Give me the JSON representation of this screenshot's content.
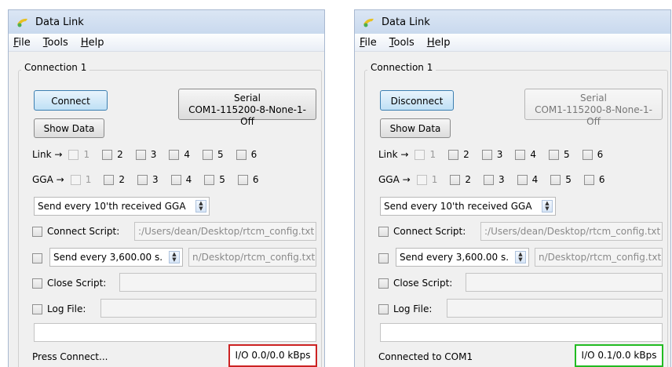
{
  "colors": {
    "io_red": "#cc2222",
    "io_green": "#22bb22"
  },
  "windows": [
    {
      "title": "Data Link",
      "menu": [
        {
          "first": "F",
          "rest": "ile"
        },
        {
          "first": "T",
          "rest": "ools"
        },
        {
          "first": "H",
          "rest": "elp"
        }
      ],
      "group_label": "Connection 1",
      "connect_label": "Connect",
      "show_data_label": "Show Data",
      "serial_line1": "Serial",
      "serial_line2": "COM1-115200-8-None-1-Off",
      "link_label": "Link →",
      "gga_label": "GGA →",
      "nums": [
        "1",
        "2",
        "3",
        "4",
        "5",
        "6"
      ],
      "send_gga": "Send every  10'th received GGA",
      "connect_script_label": "Connect Script:",
      "connect_script_path": ":/Users/dean/Desktop/rtcm_config.txt",
      "send_every": "Send every 3,600.00 s.",
      "send_every_path": "n/Desktop/rtcm_config.txt",
      "close_script_label": "Close Script:",
      "log_file_label": "Log File:",
      "status": "Press Connect...",
      "io": "I/O 0.0/0.0 kBps",
      "io_color": "#cc2222"
    },
    {
      "title": "Data Link",
      "menu": [
        {
          "first": "F",
          "rest": "ile"
        },
        {
          "first": "T",
          "rest": "ools"
        },
        {
          "first": "H",
          "rest": "elp"
        }
      ],
      "group_label": "Connection 1",
      "connect_label": "Disconnect",
      "show_data_label": "Show Data",
      "serial_line1": "Serial",
      "serial_line2": "COM1-115200-8-None-1-Off",
      "link_label": "Link →",
      "gga_label": "GGA →",
      "nums": [
        "1",
        "2",
        "3",
        "4",
        "5",
        "6"
      ],
      "send_gga": "Send every  10'th received GGA",
      "connect_script_label": "Connect Script:",
      "connect_script_path": ":/Users/dean/Desktop/rtcm_config.txt",
      "send_every": "Send every 3,600.00 s.",
      "send_every_path": "n/Desktop/rtcm_config.txt",
      "close_script_label": "Close Script:",
      "log_file_label": "Log File:",
      "status": "Connected to COM1",
      "io": "I/O 0.1/0.0 kBps",
      "io_color": "#22bb22"
    }
  ]
}
